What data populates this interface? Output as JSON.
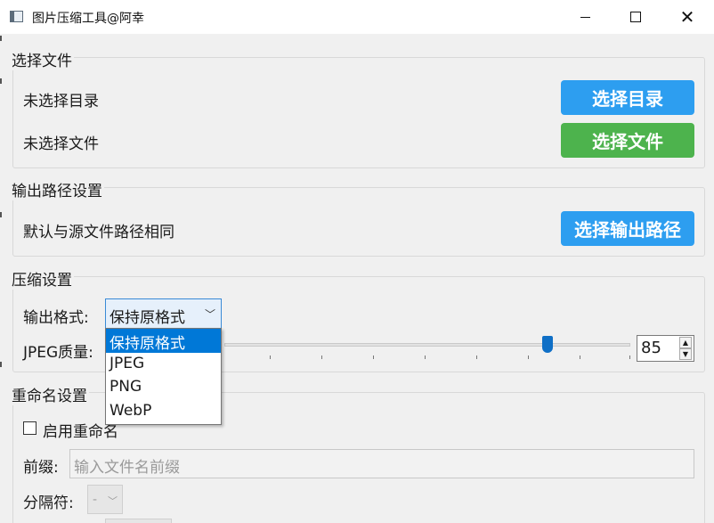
{
  "window": {
    "title": "图片压缩工具@阿幸",
    "minimize_icon": "minimize-icon",
    "maximize_icon": "maximize-icon",
    "close_icon": "close-icon"
  },
  "select_files": {
    "title": "选择文件",
    "dir_status": "未选择目录",
    "dir_button": "选择目录",
    "file_status": "未选择文件",
    "file_button": "选择文件"
  },
  "output": {
    "title": "输出路径设置",
    "path_status": "默认与源文件路径相同",
    "path_button": "选择输出路径"
  },
  "compression": {
    "title": "压缩设置",
    "format_label": "输出格式:",
    "format_selected": "保持原格式",
    "format_options": [
      "保持原格式",
      "JPEG",
      "PNG",
      "WebP"
    ],
    "quality_label": "JPEG质量:",
    "quality_value": "85"
  },
  "rename": {
    "title": "重命名设置",
    "enable_label": "启用重命名",
    "prefix_label": "前缀:",
    "prefix_placeholder": "输入文件名前缀",
    "separator_label": "分隔符:",
    "separator_value": "-"
  },
  "colors": {
    "primary_button": "#2d9ef0",
    "file_button": "#4db34d",
    "selection": "#0078d7"
  }
}
